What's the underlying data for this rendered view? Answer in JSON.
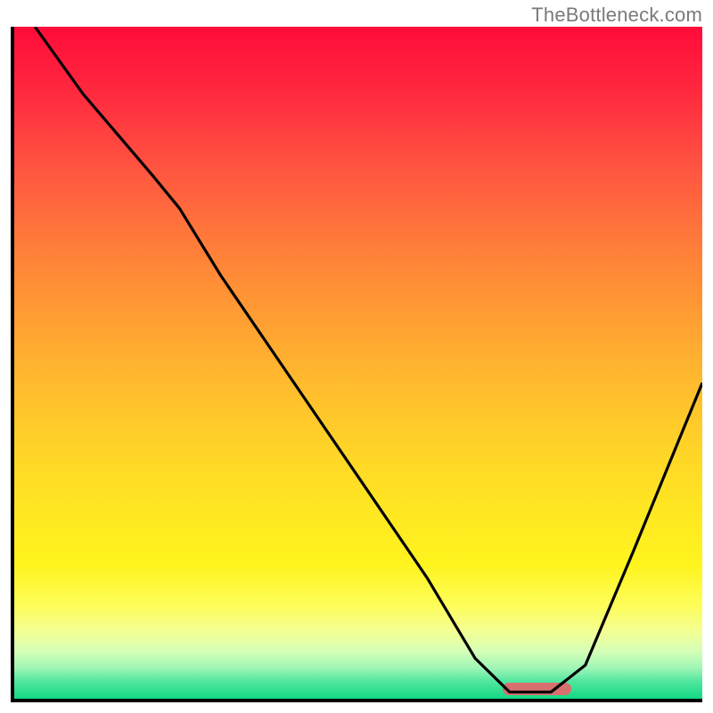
{
  "watermark": "TheBottleneck.com",
  "chart_data": {
    "type": "line",
    "title": "",
    "xlabel": "",
    "ylabel": "",
    "xlim": [
      0,
      100
    ],
    "ylim": [
      0,
      100
    ],
    "grid": false,
    "legend": false,
    "series": [
      {
        "name": "curve",
        "x": [
          3,
          10,
          20,
          24,
          30,
          40,
          50,
          60,
          67,
          72,
          78,
          83,
          90,
          100
        ],
        "y": [
          100,
          90,
          78,
          73,
          63,
          48,
          33,
          18,
          6,
          1,
          1,
          5,
          22,
          47
        ]
      }
    ],
    "marker": {
      "x_start": 71,
      "x_end": 81,
      "y": 1.5,
      "color": "#d86f6f"
    },
    "background_gradient": {
      "top": "#ff0b3a",
      "middle": "#ffe722",
      "bottom": "#13d884"
    }
  }
}
